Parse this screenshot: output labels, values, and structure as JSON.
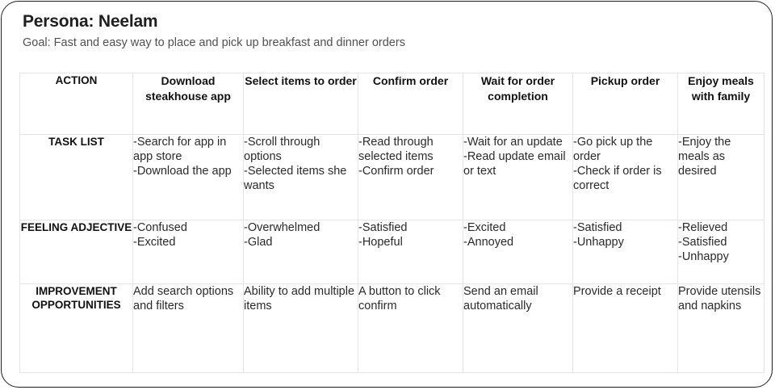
{
  "persona": {
    "title": "Persona: Neelam",
    "goal": "Goal: Fast and easy way to place and pick up breakfast and dinner orders"
  },
  "table": {
    "corner": "ACTION",
    "columns": [
      "Download steakhouse app",
      "Select items to order",
      "Confirm order",
      "Wait for order completion",
      "Pickup order",
      "Enjoy meals with family"
    ],
    "rows": [
      {
        "label": "TASK LIST",
        "cells": [
          [
            "-Search for app in app store",
            "-Download the app"
          ],
          [
            "-Scroll through options",
            "-Selected items she wants"
          ],
          [
            "-Read through selected items",
            "-Confirm order"
          ],
          [
            "-Wait for an update",
            "-Read update email or text"
          ],
          [
            "-Go pick up the order",
            "-Check if order is correct"
          ],
          [
            "-Enjoy the meals as desired"
          ]
        ]
      },
      {
        "label": "FEELING ADJECTIVE",
        "cells": [
          [
            "-Confused",
            "-Excited"
          ],
          [
            "-Overwhelmed",
            "-Glad"
          ],
          [
            "-Satisfied",
            "-Hopeful"
          ],
          [
            "-Excited",
            "-Annoyed"
          ],
          [
            "-Satisfied",
            "-Unhappy"
          ],
          [
            "-Relieved",
            "-Satisfied",
            "-Unhappy"
          ]
        ]
      },
      {
        "label": "IMPROVEMENT OPPORTUNITIES",
        "cells": [
          [
            "Add search options and filters"
          ],
          [
            "Ability to add multiple items"
          ],
          [
            "A button to click confirm"
          ],
          [
            "Send an email automatically"
          ],
          [
            "Provide a receipt"
          ],
          [
            "Provide utensils and napkins"
          ]
        ]
      }
    ]
  }
}
